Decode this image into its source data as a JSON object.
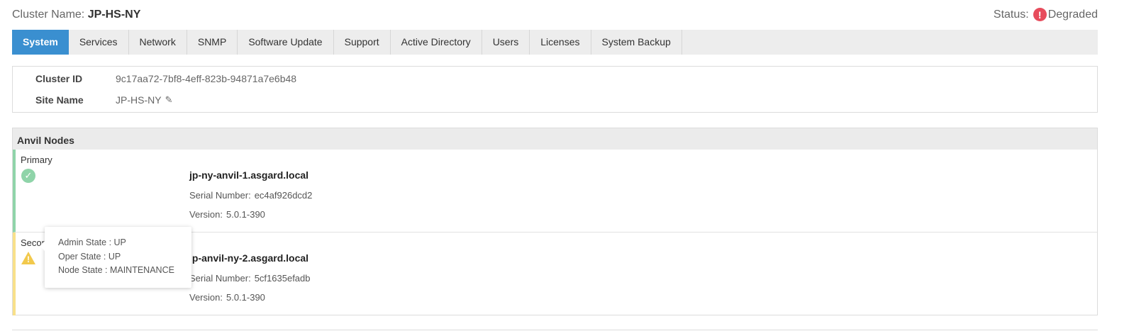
{
  "header": {
    "cluster_label": "Cluster Name:",
    "cluster_name": "JP-HS-NY",
    "status_label": "Status:",
    "status_icon": "exclamation-circle-icon",
    "status_value": "Degraded"
  },
  "tabs": [
    {
      "label": "System",
      "active": true
    },
    {
      "label": "Services"
    },
    {
      "label": "Network"
    },
    {
      "label": "SNMP"
    },
    {
      "label": "Software Update"
    },
    {
      "label": "Support"
    },
    {
      "label": "Active Directory"
    },
    {
      "label": "Users"
    },
    {
      "label": "Licenses"
    },
    {
      "label": "System Backup"
    }
  ],
  "info": {
    "cluster_id_label": "Cluster ID",
    "cluster_id_value": "9c17aa72-7bf8-4eff-823b-94871a7e6b48",
    "site_name_label": "Site Name",
    "site_name_value": "JP-HS-NY",
    "edit_icon": "pencil-icon"
  },
  "nodes": {
    "title": "Anvil Nodes",
    "primary": {
      "role": "Primary",
      "status_icon": "check-circle-icon",
      "hostname": "jp-ny-anvil-1.asgard.local",
      "serial_label": "Serial Number:",
      "serial_value": "ec4af926dcd2",
      "version_label": "Version:",
      "version_value": "5.0.1-390"
    },
    "secondary": {
      "role": "Secon",
      "status_icon": "warning-triangle-icon",
      "hostname": "jp-anvil-ny-2.asgard.local",
      "serial_label": "Serial Number:",
      "serial_value": "5cf1635efadb",
      "version_label": "Version:",
      "version_value": "5.0.1-390"
    }
  },
  "tooltip": {
    "admin_state": "Admin State : UP",
    "oper_state": "Oper State : UP",
    "node_state": "Node State : MAINTENANCE"
  },
  "colors": {
    "active_tab": "#3a8fd0",
    "status_error": "#e74c5c",
    "ok_green": "#8fd4a9",
    "warn_yellow": "#f2c94c"
  }
}
